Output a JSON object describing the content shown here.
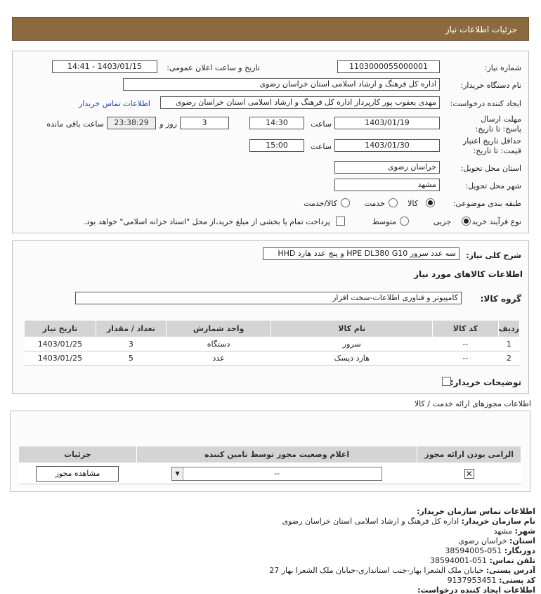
{
  "header": {
    "title": "جزئیات اطلاعات نیاز"
  },
  "need": {
    "number_label": "شماره نیاز:",
    "number": "1103000055000001",
    "announce_label": "تاریخ و ساعت اعلان عمومی:",
    "announce": "1403/01/15 - 14:41",
    "buyer_label": "نام دستگاه خریدار:",
    "buyer": "اداره کل فرهنگ و ارشاد اسلامی استان خراسان رضوی",
    "creator_label": "ایجاد کننده درخواست:",
    "creator": "مهدی یعقوب پور کارپرداز اداره کل فرهنگ و ارشاد اسلامی استان خراسان رضوی",
    "contact_link": "اطلاعات تماس خریدار",
    "deadline_label": "مهلت ارسال پاسخ: تا تاریخ:",
    "deadline_date": "1403/01/19",
    "time_label": "ساعت",
    "deadline_time": "14:30",
    "days": "3",
    "days_label": "روز و",
    "remaining": "23:38:29",
    "remaining_label": "ساعت باقی مانده",
    "validity_label_1": "حداقل تاریخ اعتبار",
    "validity_label_2": "قیمت: تا تاریخ:",
    "validity_date": "1403/01/30",
    "validity_time": "15:00",
    "province_label": "استان محل تحویل:",
    "province": "خراسان رضوی",
    "city_label": "شهر محل تحویل:",
    "city": "مشهد",
    "category_label": "طبقه بندی موضوعی:",
    "cat_goods": "کالا",
    "cat_service": "خدمت",
    "cat_both": "کالا/خدمت",
    "process_label": "نوع فرآیند خرید :",
    "proc_partial": "جزیی",
    "proc_medium": "متوسط",
    "proc_note": "پرداخت تمام یا بخشی از مبلغ خرید،از محل \"اسناد خزانه اسلامی\" خواهد بود."
  },
  "general": {
    "desc_label": "شرح کلی نیاز:",
    "desc": "سه عدد سرور HPE DL380 G10 و پنج عدد هارد HHD",
    "goods_info_title": "اطلاعات کالاهای مورد نیاز",
    "group_label": "گروه کالا:",
    "group": "کامپیوتر و فناوری اطلاعات-سخت افزار",
    "table_headers": [
      "ردیف",
      "کد کالا",
      "نام کالا",
      "واحد شمارش",
      "تعداد / مقدار",
      "تاریخ نیاز"
    ],
    "rows": [
      [
        "1",
        "--",
        "سرور",
        "دستگاه",
        "3",
        "1403/01/25"
      ],
      [
        "2",
        "--",
        "هارد دیسک",
        "عدد",
        "5",
        "1403/01/25"
      ]
    ],
    "buyer_notes_label": "توضیحات خریدار:"
  },
  "permits": {
    "title": "اطلاعات مجوزهای ارائه خدمت / کالا",
    "headers": [
      "الزامی بودن ارائه مجوز",
      "اعلام وضعیت مجوز توسط تامین کننده",
      "جزئیات"
    ],
    "status_value": "--",
    "view_button": "مشاهده مجوز"
  },
  "contact": {
    "title": "اطلاعات تماس سازمان خریدار:",
    "org_label": "نام سازمان خریدار:",
    "org": "اداره کل فرهنگ و ارشاد اسلامی استان خراسان رضوی",
    "city_label": "شهر:",
    "city": "مشهد",
    "province_label": "استان:",
    "province": "خراسان رضوی",
    "fax_label": "دورنگار:",
    "fax": "051-38594005",
    "phone_label": "تلفن تماس:",
    "phone": "051-38594001",
    "address_label": "آدرس پستی:",
    "address": "خیابان ملک الشعرا بهار-جنب استانداری-خیابان ملک الشعرا بهار 27",
    "postal_label": "کد پستی:",
    "postal": "9137953451",
    "creator_title": "اطلاعات ایجاد کننده درخواست:"
  }
}
